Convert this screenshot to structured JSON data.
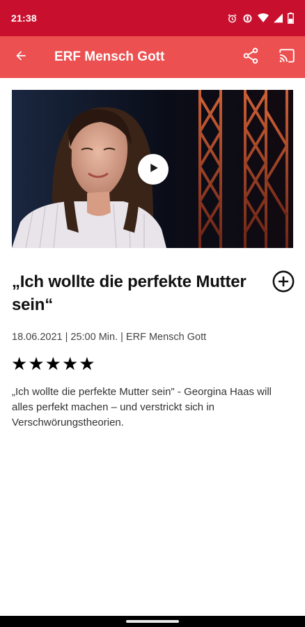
{
  "status_bar": {
    "time": "21:38",
    "icons": [
      "alarm-icon",
      "data-saver-icon",
      "wifi-icon",
      "signal-icon",
      "battery-icon"
    ]
  },
  "app_bar": {
    "title": "ERF Mensch Gott",
    "icons": [
      "arrow-back-icon",
      "share-icon",
      "cast-icon"
    ],
    "color": "#ec5050"
  },
  "video": {
    "play_icon": "play-icon"
  },
  "episode": {
    "title": "„Ich wollte die perfekte Mutter sein“",
    "meta": "18.06.2021 | 25:00 Min. | ERF Mensch Gott",
    "rating": 5,
    "rating_max": 5,
    "description": "„Ich wollte die perfekte Mutter sein\" - Georgina Haas will alles perfekt machen – und verstrickt sich in Verschwörungstheorien."
  },
  "colors": {
    "status_bar": "#c8102e",
    "app_bar": "#ec5050"
  }
}
